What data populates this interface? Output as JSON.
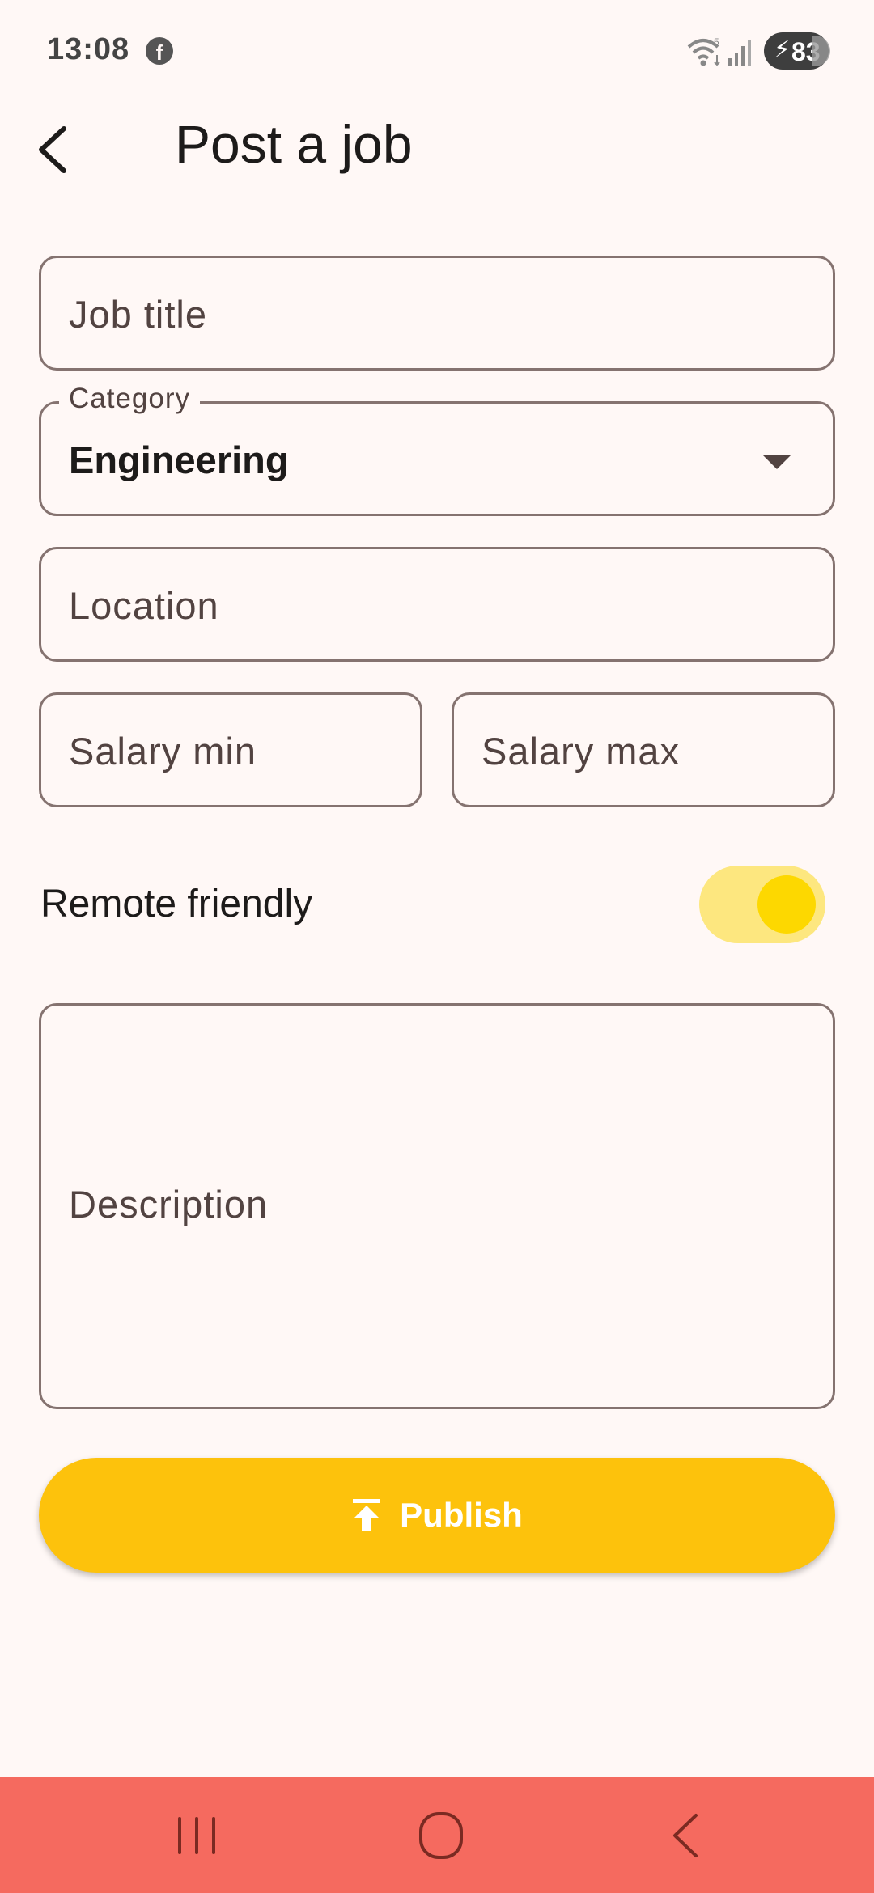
{
  "status_bar": {
    "time": "13:08",
    "battery": "83",
    "icons": [
      "facebook-icon",
      "wifi-icon",
      "signal-icon",
      "battery-charging-icon"
    ]
  },
  "app_bar": {
    "title": "Post a job",
    "back_icon": "arrow-back-icon"
  },
  "form": {
    "job_title": {
      "placeholder": "Job title",
      "value": ""
    },
    "category": {
      "label": "Category",
      "value": "Engineering"
    },
    "location": {
      "placeholder": "Location",
      "value": ""
    },
    "salary_min": {
      "placeholder": "Salary min",
      "value": ""
    },
    "salary_max": {
      "placeholder": "Salary max",
      "value": ""
    },
    "remote": {
      "label": "Remote friendly",
      "enabled": true
    },
    "description": {
      "placeholder": "Description",
      "value": ""
    }
  },
  "publish": {
    "label": "Publish",
    "icon": "upload-icon"
  },
  "colors": {
    "background": "#fff8f6",
    "outline": "#857370",
    "accent": "#fdc20c",
    "switch_track": "#fde77f",
    "switch_thumb": "#fdd800",
    "nav_bar": "#f56a5f"
  },
  "nav_bar": {
    "icons": [
      "recent-apps-icon",
      "home-icon",
      "back-icon"
    ]
  }
}
